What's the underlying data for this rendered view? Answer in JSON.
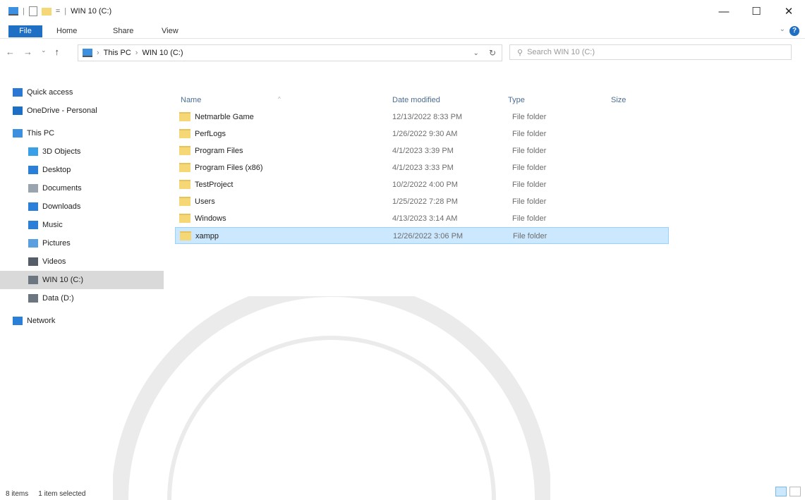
{
  "window": {
    "title": "WIN 10 (C:)",
    "minimize_glyph": "—",
    "maximize_glyph": "☐",
    "close_glyph": "✕"
  },
  "ribbon": {
    "tabs": [
      "File",
      "Home",
      "Share",
      "View"
    ],
    "help_glyph": "?",
    "collapse_glyph": "⌄"
  },
  "nav": {
    "back_glyph": "←",
    "forward_glyph": "→",
    "recent_glyph": "⌄",
    "up_glyph": "↑",
    "breadcrumb": [
      "This PC",
      "WIN 10 (C:)"
    ],
    "crumb_sep": "›",
    "dropdown_glyph": "⌄",
    "refresh_glyph": "↻",
    "search_placeholder": "Search WIN 10 (C:)"
  },
  "sidebar": {
    "items": [
      {
        "label": "Quick access",
        "icon": "star-icon",
        "color": "#2b78d4",
        "top": true
      },
      {
        "label": "OneDrive - Personal",
        "icon": "cloud-icon",
        "color": "#1c6fc4",
        "top": true
      },
      {
        "label": "This PC",
        "icon": "computer-icon",
        "color": "#3d8fe0",
        "top": true
      },
      {
        "label": "3D Objects",
        "icon": "cube-icon",
        "color": "#39a0e8",
        "top": false
      },
      {
        "label": "Desktop",
        "icon": "desktop-icon",
        "color": "#2a7fd8",
        "top": false
      },
      {
        "label": "Documents",
        "icon": "document-icon",
        "color": "#9aa4ae",
        "top": false
      },
      {
        "label": "Downloads",
        "icon": "download-icon",
        "color": "#2a7fd8",
        "top": false
      },
      {
        "label": "Music",
        "icon": "music-icon",
        "color": "#2a7fd8",
        "top": false
      },
      {
        "label": "Pictures",
        "icon": "pictures-icon",
        "color": "#5aa0e0",
        "top": false
      },
      {
        "label": "Videos",
        "icon": "video-icon",
        "color": "#555e68",
        "top": false
      },
      {
        "label": "WIN 10 (C:)",
        "icon": "drive-icon",
        "color": "#6b7680",
        "top": false,
        "selected": true
      },
      {
        "label": "Data (D:)",
        "icon": "drive-icon",
        "color": "#6b7680",
        "top": false
      },
      {
        "label": "Network",
        "icon": "network-icon",
        "color": "#2a7fd8",
        "top": true
      }
    ]
  },
  "table": {
    "columns": {
      "name": "Name",
      "date": "Date modified",
      "type": "Type",
      "size": "Size"
    },
    "sort_glyph": "^",
    "rows": [
      {
        "name": "Netmarble Game",
        "date": "12/13/2022 8:33 PM",
        "type": "File folder"
      },
      {
        "name": "PerfLogs",
        "date": "1/26/2022 9:30 AM",
        "type": "File folder"
      },
      {
        "name": "Program Files",
        "date": "4/1/2023 3:39 PM",
        "type": "File folder"
      },
      {
        "name": "Program Files (x86)",
        "date": "4/1/2023 3:33 PM",
        "type": "File folder"
      },
      {
        "name": "TestProject",
        "date": "10/2/2022 4:00 PM",
        "type": "File folder"
      },
      {
        "name": "Users",
        "date": "1/25/2022 7:28 PM",
        "type": "File folder"
      },
      {
        "name": "Windows",
        "date": "4/13/2023 3:14 AM",
        "type": "File folder"
      },
      {
        "name": "xampp",
        "date": "12/26/2022 3:06 PM",
        "type": "File folder",
        "selected": true
      }
    ]
  },
  "status": {
    "count": "8 items",
    "selection": "1 item selected"
  },
  "colors": {
    "accent": "#1f6fc5",
    "selection": "#cce8ff",
    "folder": "#f6d776"
  }
}
